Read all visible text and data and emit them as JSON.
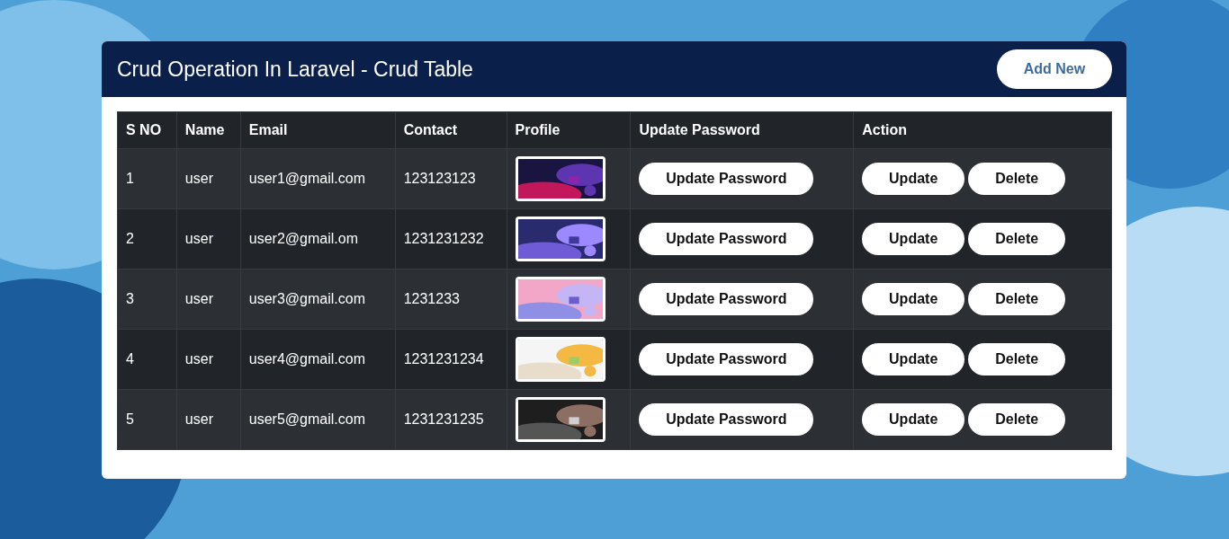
{
  "header": {
    "title": "Crud Operation In Laravel - Crud Table",
    "add_button": "Add New"
  },
  "table": {
    "columns": [
      "S NO",
      "Name",
      "Email",
      "Contact",
      "Profile",
      "Update Password",
      "Action"
    ],
    "rows": [
      {
        "sno": "1",
        "name": "user",
        "email": "user1@gmail.com",
        "contact": "123123123",
        "update_password": "Update Password",
        "actions": [
          "Update",
          "Delete"
        ]
      },
      {
        "sno": "2",
        "name": "user",
        "email": "user2@gmail.om",
        "contact": "1231231232",
        "update_password": "Update Password",
        "actions": [
          "Update",
          "Delete"
        ]
      },
      {
        "sno": "3",
        "name": "user",
        "email": "user3@gmail.com",
        "contact": "1231233",
        "update_password": "Update Password",
        "actions": [
          "Update",
          "Delete"
        ]
      },
      {
        "sno": "4",
        "name": "user",
        "email": "user4@gmail.com",
        "contact": "1231231234",
        "update_password": "Update Password",
        "actions": [
          "Update",
          "Delete"
        ]
      },
      {
        "sno": "5",
        "name": "user",
        "email": "user5@gmail.com",
        "contact": "1231231235",
        "update_password": "Update Password",
        "actions": [
          "Update",
          "Delete"
        ]
      }
    ]
  }
}
